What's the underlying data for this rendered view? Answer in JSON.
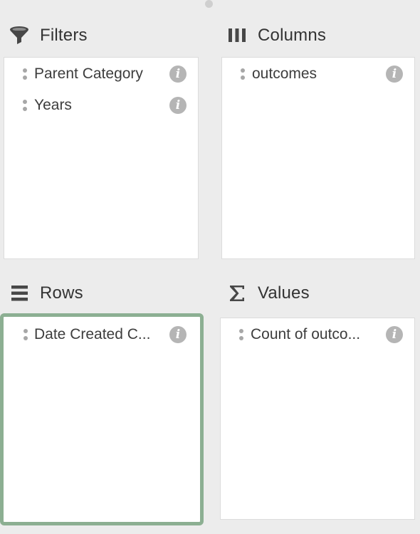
{
  "areas": {
    "filters": {
      "title": "Filters",
      "icon": "filter-funnel-icon",
      "fields": [
        {
          "label": "Parent Category"
        },
        {
          "label": "Years"
        }
      ]
    },
    "columns": {
      "title": "Columns",
      "icon": "columns-icon",
      "fields": [
        {
          "label": "outcomes"
        }
      ]
    },
    "rows": {
      "title": "Rows",
      "icon": "rows-icon",
      "fields": [
        {
          "label": "Date Created C..."
        }
      ]
    },
    "values": {
      "title": "Values",
      "icon": "sigma-icon",
      "fields": [
        {
          "label": "Count of outco..."
        }
      ]
    }
  },
  "info_icon_glyph": "i",
  "colors": {
    "background": "#ececec",
    "panel": "#ffffff",
    "active_border": "#8caf92",
    "info_icon": "#b5b5b5",
    "grip": "#a7a7a7"
  }
}
